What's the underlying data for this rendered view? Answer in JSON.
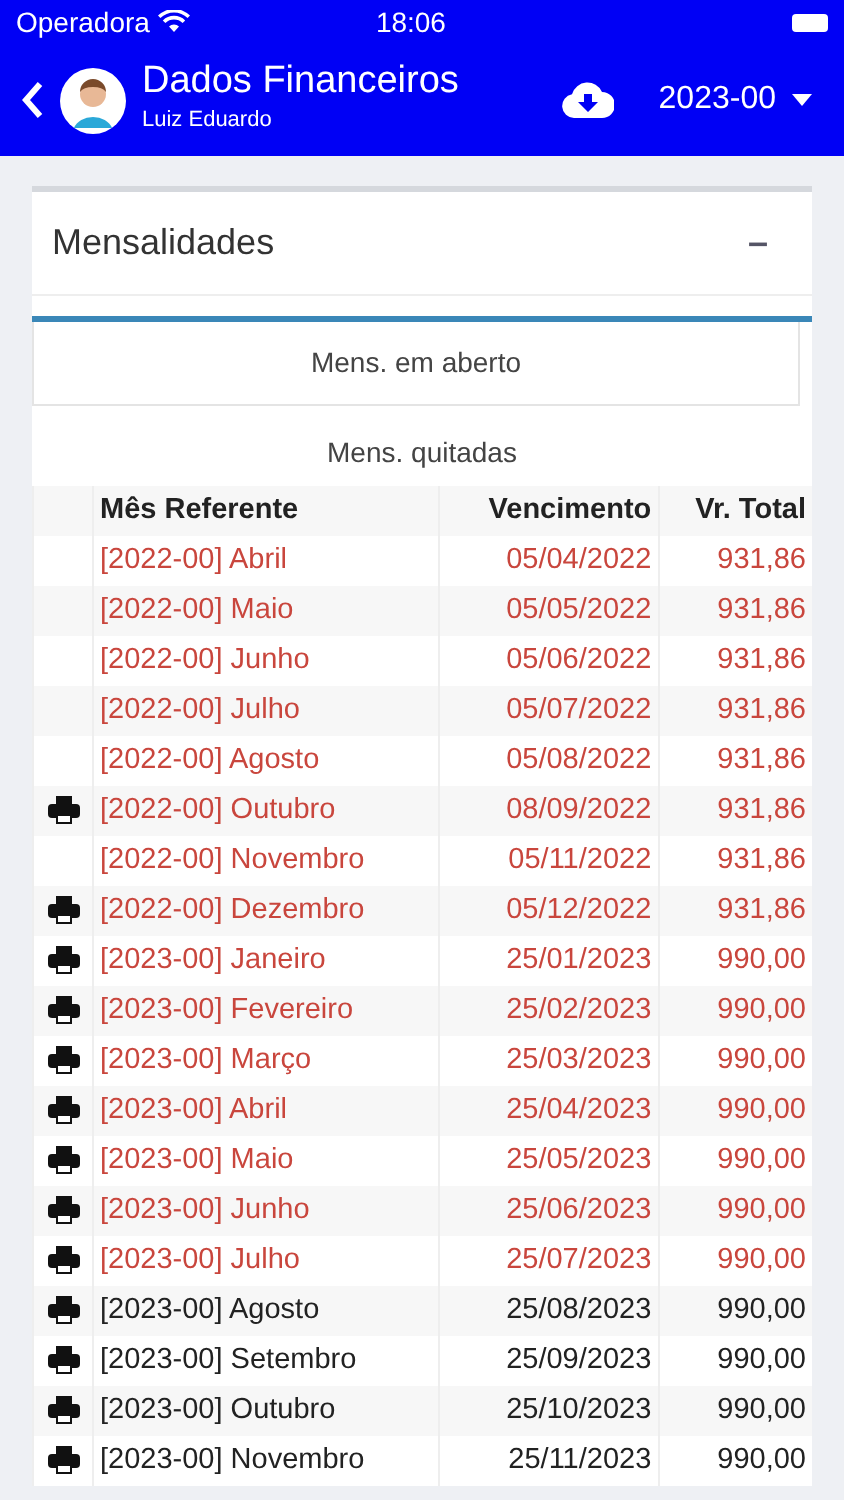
{
  "status_bar": {
    "carrier": "Operadora",
    "time": "18:06"
  },
  "header": {
    "title": "Dados Financeiros",
    "subtitle": "Luiz Eduardo",
    "year": "2023-00"
  },
  "panel": {
    "title": "Mensalidades",
    "collapse_symbol": "–"
  },
  "tabs": [
    {
      "label": "Mens. em aberto",
      "selected": true
    },
    {
      "label": "Mens. quitadas",
      "selected": false
    }
  ],
  "table": {
    "columns": [
      "Mês Referente",
      "Vencimento",
      "Vr. Total"
    ],
    "rows": [
      {
        "month": "[2022-00] Abril",
        "due": "05/04/2022",
        "total": "931,86",
        "printable": false,
        "late": true
      },
      {
        "month": "[2022-00] Maio",
        "due": "05/05/2022",
        "total": "931,86",
        "printable": false,
        "late": true
      },
      {
        "month": "[2022-00] Junho",
        "due": "05/06/2022",
        "total": "931,86",
        "printable": false,
        "late": true
      },
      {
        "month": "[2022-00] Julho",
        "due": "05/07/2022",
        "total": "931,86",
        "printable": false,
        "late": true
      },
      {
        "month": "[2022-00] Agosto",
        "due": "05/08/2022",
        "total": "931,86",
        "printable": false,
        "late": true
      },
      {
        "month": "[2022-00] Outubro",
        "due": "08/09/2022",
        "total": "931,86",
        "printable": true,
        "late": true
      },
      {
        "month": "[2022-00] Novembro",
        "due": "05/11/2022",
        "total": "931,86",
        "printable": false,
        "late": true
      },
      {
        "month": "[2022-00] Dezembro",
        "due": "05/12/2022",
        "total": "931,86",
        "printable": true,
        "late": true
      },
      {
        "month": "[2023-00] Janeiro",
        "due": "25/01/2023",
        "total": "990,00",
        "printable": true,
        "late": true
      },
      {
        "month": "[2023-00] Fevereiro",
        "due": "25/02/2023",
        "total": "990,00",
        "printable": true,
        "late": true
      },
      {
        "month": "[2023-00] Março",
        "due": "25/03/2023",
        "total": "990,00",
        "printable": true,
        "late": true
      },
      {
        "month": "[2023-00] Abril",
        "due": "25/04/2023",
        "total": "990,00",
        "printable": true,
        "late": true
      },
      {
        "month": "[2023-00] Maio",
        "due": "25/05/2023",
        "total": "990,00",
        "printable": true,
        "late": true
      },
      {
        "month": "[2023-00] Junho",
        "due": "25/06/2023",
        "total": "990,00",
        "printable": true,
        "late": true
      },
      {
        "month": "[2023-00] Julho",
        "due": "25/07/2023",
        "total": "990,00",
        "printable": true,
        "late": true
      },
      {
        "month": "[2023-00] Agosto",
        "due": "25/08/2023",
        "total": "990,00",
        "printable": true,
        "late": false
      },
      {
        "month": "[2023-00] Setembro",
        "due": "25/09/2023",
        "total": "990,00",
        "printable": true,
        "late": false
      },
      {
        "month": "[2023-00] Outubro",
        "due": "25/10/2023",
        "total": "990,00",
        "printable": true,
        "late": false
      },
      {
        "month": "[2023-00] Novembro",
        "due": "25/11/2023",
        "total": "990,00",
        "printable": true,
        "late": false
      }
    ]
  }
}
